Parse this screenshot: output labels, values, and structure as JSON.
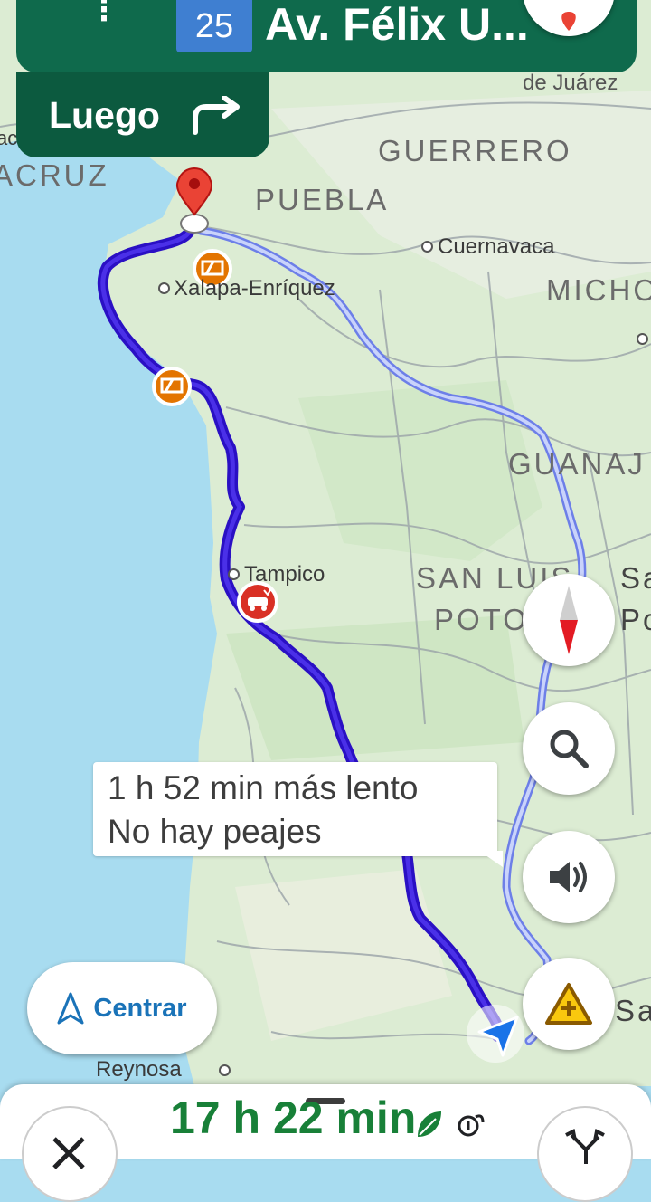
{
  "header": {
    "menu_glyph": "⋮",
    "road_number": "25",
    "street": "Av. Félix U...",
    "then_label": "Luego"
  },
  "map": {
    "labels": {
      "de_juarez": "de Juárez",
      "veracruz": "ACRUZ",
      "veracruz_prefix": "ac",
      "guerrero": "GUERRERO",
      "puebla": "PUEBLA",
      "cuernavaca": "Cuernavaca",
      "xalapa": "Xalapa-Enríquez",
      "michoacan": "MICHO",
      "guanajuato": "GUANAJ",
      "tampico": "Tampico",
      "san_luis": "SAN LUIS",
      "potosi": "POTO",
      "sa_right": "Sa",
      "po_right": "Po",
      "sa_bottom": "Sa",
      "reynosa": "Reynosa"
    },
    "colors": {
      "water": "#a8dcf0",
      "land": "#dcecd3",
      "route_primary": "#3a1fd6",
      "route_alt": "#8ea0f5"
    }
  },
  "route_info": {
    "line1": "1 h 52 min más lento",
    "line2": "No hay peajes"
  },
  "buttons": {
    "recenter_label": "Centrar"
  },
  "bottom_bar": {
    "eta": "17 h 22 min"
  }
}
